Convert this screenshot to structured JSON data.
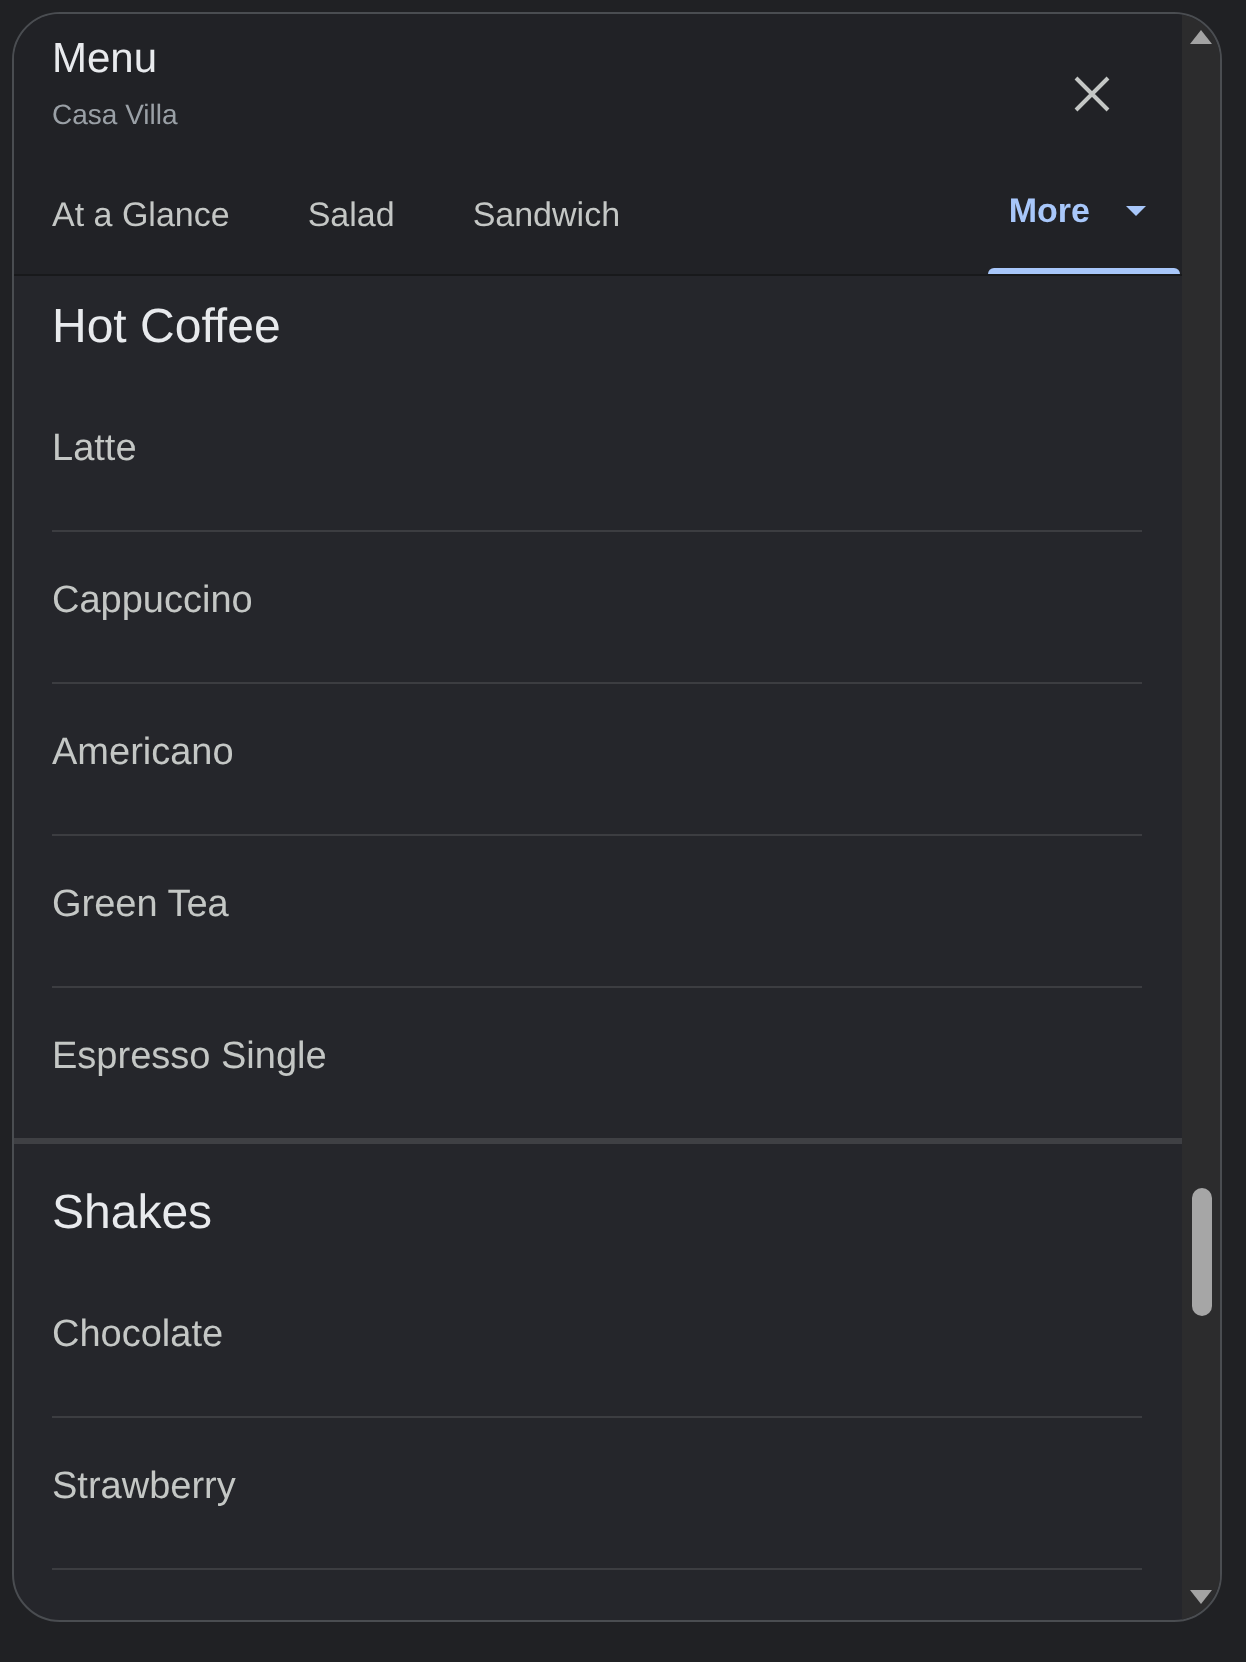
{
  "header": {
    "title": "Menu",
    "subtitle": "Casa Villa"
  },
  "tabs": [
    {
      "label": "At a Glance",
      "selected": false,
      "kind": "tab"
    },
    {
      "label": "Salad",
      "selected": false,
      "kind": "tab"
    },
    {
      "label": "Sandwich",
      "selected": false,
      "kind": "tab"
    },
    {
      "label": "More",
      "selected": true,
      "kind": "dropdown"
    }
  ],
  "sections": [
    {
      "title": "Hot Coffee",
      "items": [
        "Latte",
        "Cappuccino",
        "Americano",
        "Green Tea",
        "Espresso Single"
      ]
    },
    {
      "title": "Shakes",
      "items": [
        "Chocolate",
        "Strawberry"
      ]
    }
  ]
}
